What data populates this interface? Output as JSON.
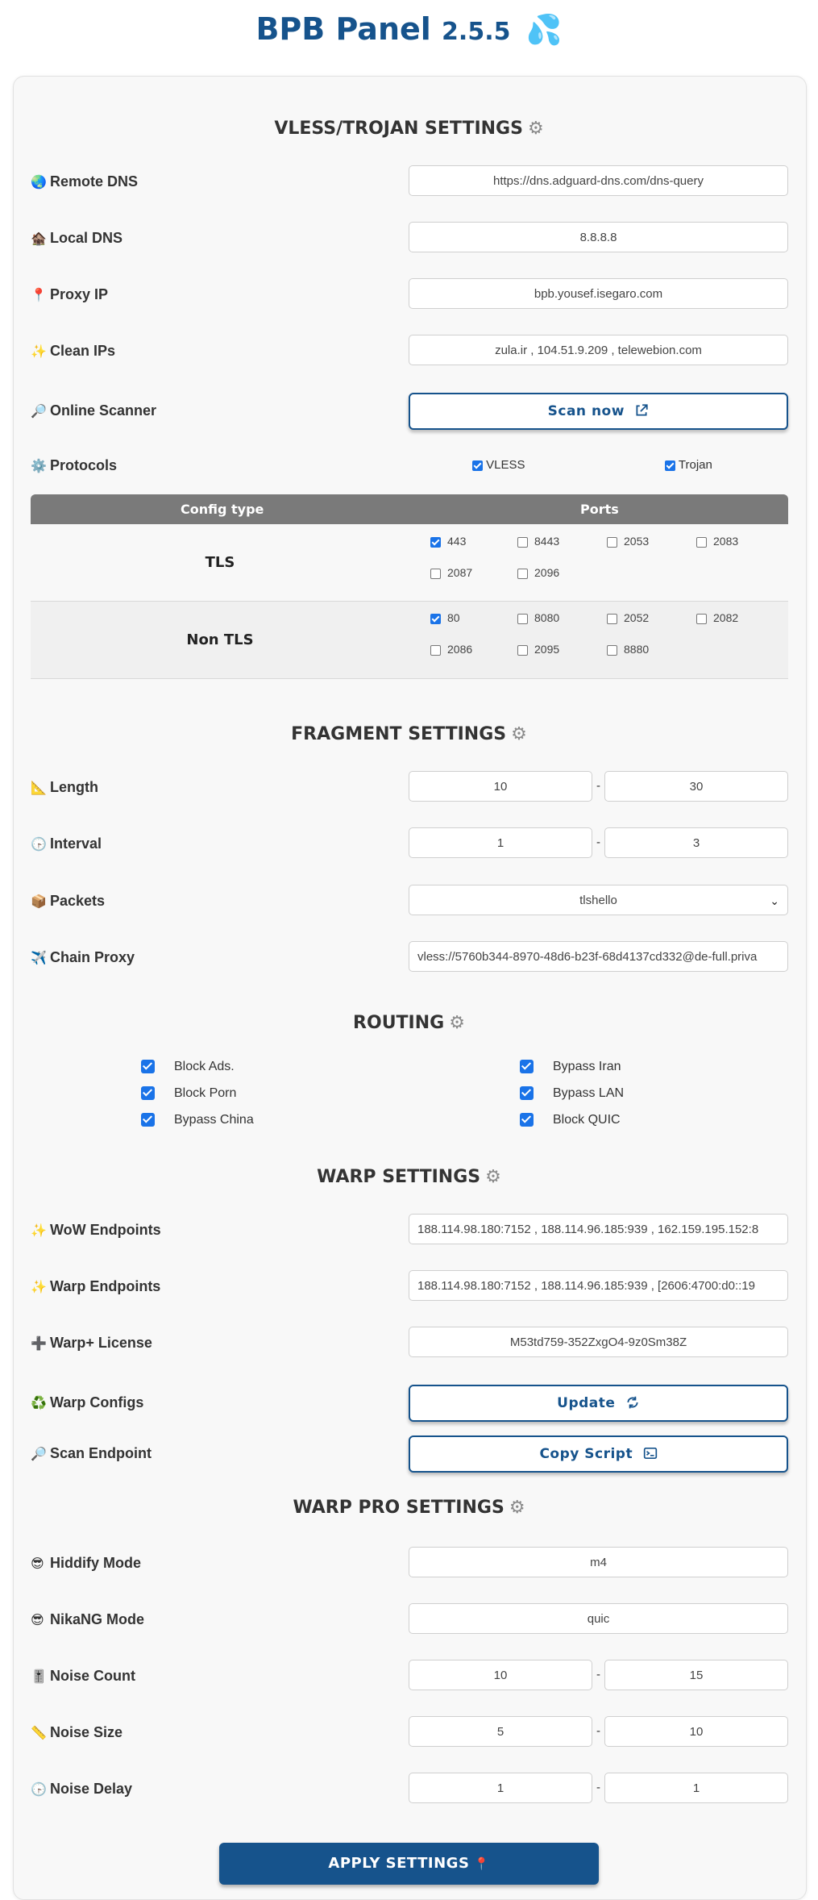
{
  "header": {
    "title": "BPB Panel",
    "version": "2.5.5",
    "icon": "💦"
  },
  "sections": {
    "vless": "VLESS/TROJAN SETTINGS",
    "fragment": "FRAGMENT SETTINGS",
    "routing": "ROUTING",
    "warp": "WARP SETTINGS",
    "warp_pro": "WARP PRO SETTINGS"
  },
  "vless": {
    "remote_dns": {
      "label": "Remote DNS",
      "icon": "🌏",
      "value": "https://dns.adguard-dns.com/dns-query"
    },
    "local_dns": {
      "label": "Local DNS",
      "icon": "🏚️",
      "value": "8.8.8.8"
    },
    "proxy_ip": {
      "label": "Proxy IP",
      "icon": "📍",
      "value": "bpb.yousef.isegaro.com"
    },
    "clean_ips": {
      "label": "Clean IPs",
      "icon": "✨",
      "value": "zula.ir , 104.51.9.209 , telewebion.com"
    },
    "online_scanner": {
      "label": "Online Scanner",
      "icon": "🔎",
      "button": "Scan now"
    },
    "protocols": {
      "label": "Protocols",
      "icon": "⚙️",
      "vless": "VLESS",
      "trojan": "Trojan",
      "vless_checked": true,
      "trojan_checked": true
    }
  },
  "ports": {
    "header_config": "Config type",
    "header_ports": "Ports",
    "tls": {
      "label": "TLS",
      "ports": [
        "443",
        "8443",
        "2053",
        "2083",
        "2087",
        "2096"
      ],
      "checked": [
        true,
        false,
        false,
        false,
        false,
        false
      ]
    },
    "nontls": {
      "label": "Non TLS",
      "ports": [
        "80",
        "8080",
        "2052",
        "2082",
        "2086",
        "2095",
        "8880"
      ],
      "checked": [
        true,
        false,
        false,
        false,
        false,
        false,
        false
      ]
    }
  },
  "fragment": {
    "length": {
      "label": "Length",
      "icon": "📐",
      "min": "10",
      "max": "30"
    },
    "interval": {
      "label": "Interval",
      "icon": "🕞",
      "min": "1",
      "max": "3"
    },
    "packets": {
      "label": "Packets",
      "icon": "📦",
      "value": "tlshello"
    },
    "chain_proxy": {
      "label": "Chain Proxy",
      "icon": "✈️",
      "value": "vless://5760b344-8970-48d6-b23f-68d4137cd332@de-full.priva"
    }
  },
  "routing": {
    "items": [
      {
        "label": "Block Ads.",
        "checked": true
      },
      {
        "label": "Bypass Iran",
        "checked": true
      },
      {
        "label": "Block Porn",
        "checked": true
      },
      {
        "label": "Bypass LAN",
        "checked": true
      },
      {
        "label": "Bypass China",
        "checked": true
      },
      {
        "label": "Block QUIC",
        "checked": true
      }
    ]
  },
  "warp": {
    "wow_endpoints": {
      "label": "WoW Endpoints",
      "icon": "✨",
      "value": "188.114.98.180:7152 , 188.114.96.185:939 , 162.159.195.152:8"
    },
    "warp_endpoints": {
      "label": "Warp Endpoints",
      "icon": "✨",
      "value": "188.114.98.180:7152 , 188.114.96.185:939 , [2606:4700:d0::19"
    },
    "warp_license": {
      "label": "Warp+ License",
      "icon": "➕",
      "value": "M53td759-352ZxgO4-9z0Sm38Z"
    },
    "warp_configs": {
      "label": "Warp Configs",
      "icon": "♻️",
      "button": "Update"
    },
    "scan_endpoint": {
      "label": "Scan Endpoint",
      "icon": "🔎",
      "button": "Copy Script"
    }
  },
  "warp_pro": {
    "hiddify": {
      "label": "Hiddify Mode",
      "icon": "😎",
      "value": "m4"
    },
    "nikang": {
      "label": "NikaNG Mode",
      "icon": "😎",
      "value": "quic"
    },
    "noise_count": {
      "label": "Noise Count",
      "icon": "🎚️",
      "min": "10",
      "max": "15"
    },
    "noise_size": {
      "label": "Noise Size",
      "icon": "📏",
      "min": "5",
      "max": "10"
    },
    "noise_delay": {
      "label": "Noise Delay",
      "icon": "🕞",
      "min": "1",
      "max": "1"
    }
  },
  "apply_button": "APPLY SETTINGS",
  "apply_icon": "📍"
}
